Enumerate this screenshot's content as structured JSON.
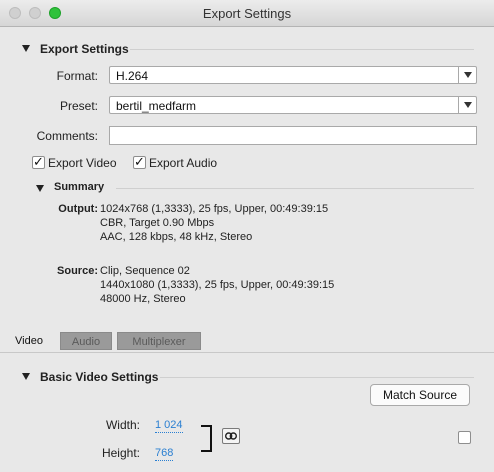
{
  "window": {
    "title": "Export Settings"
  },
  "export_settings": {
    "section_title": "Export Settings",
    "format": {
      "label": "Format:",
      "value": "H.264"
    },
    "preset": {
      "label": "Preset:",
      "value": "bertil_medfarm"
    },
    "comments": {
      "label": "Comments:",
      "value": ""
    },
    "export_video": {
      "label": "Export Video",
      "checked": true
    },
    "export_audio": {
      "label": "Export Audio",
      "checked": true
    }
  },
  "summary": {
    "title": "Summary",
    "output_label": "Output:",
    "output_lines": [
      "1024x768 (1,3333), 25 fps, Upper, 00:49:39:15",
      "CBR, Target 0.90 Mbps",
      "AAC, 128 kbps, 48 kHz, Stereo"
    ],
    "source_label": "Source:",
    "source_lines": [
      "Clip, Sequence 02",
      "1440x1080 (1,3333), 25 fps, Upper, 00:49:39:15",
      "48000 Hz, Stereo"
    ]
  },
  "tabs": [
    {
      "label": "Video",
      "active": true
    },
    {
      "label": "Audio",
      "active": false
    },
    {
      "label": "Multiplexer",
      "active": false
    }
  ],
  "basic_video": {
    "section_title": "Basic Video Settings",
    "match_source_label": "Match Source",
    "width": {
      "label": "Width:",
      "value": "1 024"
    },
    "height": {
      "label": "Height:",
      "value": "768"
    },
    "constrain_icon": "chain-link-icon"
  }
}
